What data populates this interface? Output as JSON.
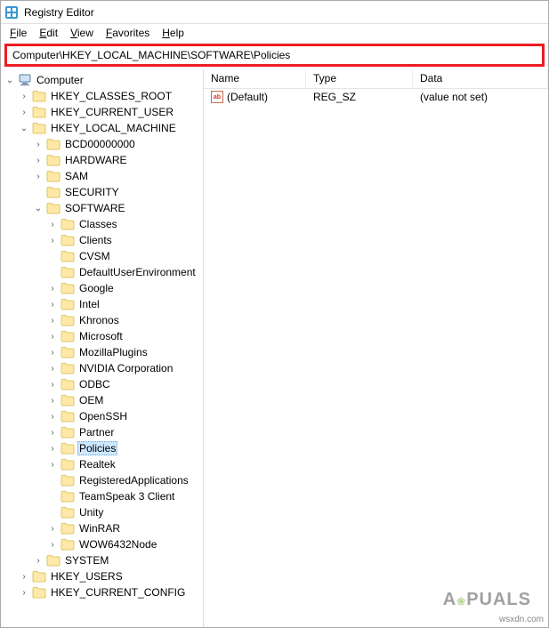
{
  "window": {
    "title": "Registry Editor"
  },
  "menu": [
    "File",
    "Edit",
    "View",
    "Favorites",
    "Help"
  ],
  "address": "Computer\\HKEY_LOCAL_MACHINE\\SOFTWARE\\Policies",
  "columns": {
    "name": "Name",
    "type": "Type",
    "data": "Data"
  },
  "rows": [
    {
      "icon": "ab",
      "name": "(Default)",
      "type": "REG_SZ",
      "data": "(value not set)"
    }
  ],
  "tree": {
    "root": "Computer",
    "hives": [
      {
        "label": "HKEY_CLASSES_ROOT",
        "expandable": true,
        "expanded": false
      },
      {
        "label": "HKEY_CURRENT_USER",
        "expandable": true,
        "expanded": false
      },
      {
        "label": "HKEY_LOCAL_MACHINE",
        "expandable": true,
        "expanded": true,
        "children": [
          {
            "label": "BCD00000000",
            "expandable": true
          },
          {
            "label": "HARDWARE",
            "expandable": true
          },
          {
            "label": "SAM",
            "expandable": true
          },
          {
            "label": "SECURITY",
            "expandable": false
          },
          {
            "label": "SOFTWARE",
            "expandable": true,
            "expanded": true,
            "children": [
              {
                "label": "Classes",
                "expandable": true
              },
              {
                "label": "Clients",
                "expandable": true
              },
              {
                "label": "CVSM",
                "expandable": false
              },
              {
                "label": "DefaultUserEnvironment",
                "expandable": false
              },
              {
                "label": "Google",
                "expandable": true
              },
              {
                "label": "Intel",
                "expandable": true
              },
              {
                "label": "Khronos",
                "expandable": true
              },
              {
                "label": "Microsoft",
                "expandable": true
              },
              {
                "label": "MozillaPlugins",
                "expandable": true
              },
              {
                "label": "NVIDIA Corporation",
                "expandable": true
              },
              {
                "label": "ODBC",
                "expandable": true
              },
              {
                "label": "OEM",
                "expandable": true
              },
              {
                "label": "OpenSSH",
                "expandable": true
              },
              {
                "label": "Partner",
                "expandable": true
              },
              {
                "label": "Policies",
                "expandable": true,
                "selected": true
              },
              {
                "label": "Realtek",
                "expandable": true
              },
              {
                "label": "RegisteredApplications",
                "expandable": false
              },
              {
                "label": "TeamSpeak 3 Client",
                "expandable": false
              },
              {
                "label": "Unity",
                "expandable": false
              },
              {
                "label": "WinRAR",
                "expandable": true
              },
              {
                "label": "WOW6432Node",
                "expandable": true
              }
            ]
          },
          {
            "label": "SYSTEM",
            "expandable": true
          }
        ]
      },
      {
        "label": "HKEY_USERS",
        "expandable": true,
        "expanded": false
      },
      {
        "label": "HKEY_CURRENT_CONFIG",
        "expandable": true,
        "expanded": false
      }
    ]
  },
  "watermark": {
    "text": "APPUALS",
    "small": "wsxdn.com"
  }
}
